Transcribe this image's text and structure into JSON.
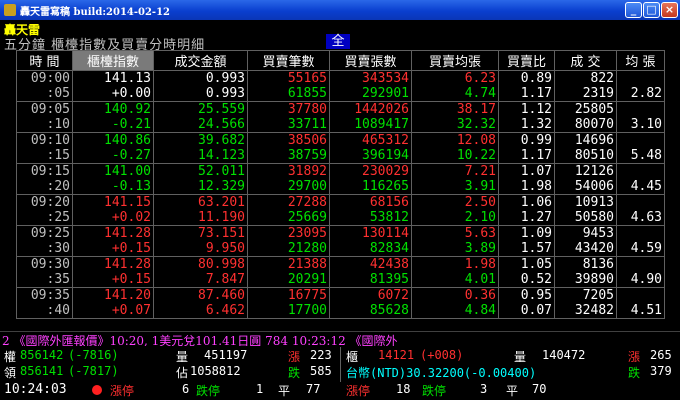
{
  "window": {
    "title": "轟天雷寫稿 build:2014-02-12"
  },
  "brand": "轟天雷",
  "page": {
    "title": "五分鐘  櫃檯指數及買賣分時明細",
    "all_button": "全"
  },
  "columns": [
    "時 間",
    "櫃檯指數",
    "成交金額",
    "買賣筆數",
    "買賣張數",
    "買賣均張",
    "買賣比",
    "成 交",
    "均 張"
  ],
  "rows": [
    {
      "time": "09:00",
      "idx": "141.13",
      "amt": "0.993",
      "cnt": "55165",
      "vol": "343534",
      "avg": "6.23",
      "ratio": "0.89",
      "deal": "822",
      "avgz": ""
    },
    {
      "time": ":05",
      "idx": "+0.00",
      "amt": "0.993",
      "cnt": "61855",
      "vol": "292901",
      "avg": "4.74",
      "ratio": "1.17",
      "deal": "2319",
      "avgz": "2.82"
    },
    {
      "time": "09:05",
      "idx": "140.92",
      "amt": "25.559",
      "cnt": "37780",
      "vol": "1442026",
      "avg": "38.17",
      "ratio": "1.12",
      "deal": "25805",
      "avgz": ""
    },
    {
      "time": ":10",
      "idx": "-0.21",
      "amt": "24.566",
      "cnt": "33711",
      "vol": "1089417",
      "avg": "32.32",
      "ratio": "1.32",
      "deal": "80070",
      "avgz": "3.10"
    },
    {
      "time": "09:10",
      "idx": "140.86",
      "amt": "39.682",
      "cnt": "38506",
      "vol": "465312",
      "avg": "12.08",
      "ratio": "0.99",
      "deal": "14696",
      "avgz": ""
    },
    {
      "time": ":15",
      "idx": "-0.27",
      "amt": "14.123",
      "cnt": "38759",
      "vol": "396194",
      "avg": "10.22",
      "ratio": "1.17",
      "deal": "80510",
      "avgz": "5.48"
    },
    {
      "time": "09:15",
      "idx": "141.00",
      "amt": "52.011",
      "cnt": "31892",
      "vol": "230029",
      "avg": "7.21",
      "ratio": "1.07",
      "deal": "12126",
      "avgz": ""
    },
    {
      "time": ":20",
      "idx": "-0.13",
      "amt": "12.329",
      "cnt": "29700",
      "vol": "116265",
      "avg": "3.91",
      "ratio": "1.98",
      "deal": "54006",
      "avgz": "4.45"
    },
    {
      "time": "09:20",
      "idx": "141.15",
      "amt": "63.201",
      "cnt": "27288",
      "vol": "68156",
      "avg": "2.50",
      "ratio": "1.06",
      "deal": "10913",
      "avgz": ""
    },
    {
      "time": ":25",
      "idx": "+0.02",
      "amt": "11.190",
      "cnt": "25669",
      "vol": "53812",
      "avg": "2.10",
      "ratio": "1.27",
      "deal": "50580",
      "avgz": "4.63"
    },
    {
      "time": "09:25",
      "idx": "141.28",
      "amt": "73.151",
      "cnt": "23095",
      "vol": "130114",
      "avg": "5.63",
      "ratio": "1.09",
      "deal": "9453",
      "avgz": ""
    },
    {
      "time": ":30",
      "idx": "+0.15",
      "amt": "9.950",
      "cnt": "21280",
      "vol": "82834",
      "avg": "3.89",
      "ratio": "1.57",
      "deal": "43420",
      "avgz": "4.59"
    },
    {
      "time": "09:30",
      "idx": "141.28",
      "amt": "80.998",
      "cnt": "21388",
      "vol": "42438",
      "avg": "1.98",
      "ratio": "1.05",
      "deal": "8136",
      "avgz": ""
    },
    {
      "time": ":35",
      "idx": "+0.15",
      "amt": "7.847",
      "cnt": "20291",
      "vol": "81395",
      "avg": "4.01",
      "ratio": "0.52",
      "deal": "39890",
      "avgz": "4.90"
    },
    {
      "time": "09:35",
      "idx": "141.20",
      "amt": "87.460",
      "cnt": "16775",
      "vol": "6072",
      "avg": "0.36",
      "ratio": "0.95",
      "deal": "7205",
      "avgz": ""
    },
    {
      "time": ":40",
      "idx": "+0.07",
      "amt": "6.462",
      "cnt": "17700",
      "vol": "85628",
      "avg": "4.84",
      "ratio": "0.07",
      "deal": "32482",
      "avgz": "4.51"
    }
  ],
  "ticker": "2 《國際外匯報價》10:20, 1美元兌101.41日圓     784  10:23:12  《國際外",
  "bottom": {
    "l1": {
      "k": "權",
      "v": "856142",
      "c": "(-7816)",
      "vk": "量",
      "vv": "451197",
      "uk": "漲",
      "uv": "223"
    },
    "l2": {
      "k": "領",
      "v": "856141",
      "c": "(-7817)",
      "vk": "佔",
      "vv": "1058812",
      "uk": "跌",
      "uv": "585"
    },
    "r1": {
      "k": "櫃",
      "v": "14121",
      "c": "(+008)",
      "vk": "量",
      "vv": "140472",
      "uk": "漲",
      "uv": "265"
    },
    "r2": {
      "k": "台幣(NTD)30.32200(-0.00400)",
      "uk": "跌",
      "uv": "379"
    },
    "time": "10:24:03",
    "l3": {
      "a": "漲停",
      "av": "6",
      "b": "跌停",
      "bv": "1",
      "c": "平",
      "cv": "77"
    },
    "r3": {
      "a": "漲停",
      "av": "18",
      "b": "跌停",
      "bv": "3",
      "c": "平",
      "cv": "70"
    }
  },
  "colors": {
    "up": "#ff3030",
    "down": "#00e000",
    "time": "#c0c0c0",
    "accent": "#ffff00"
  }
}
